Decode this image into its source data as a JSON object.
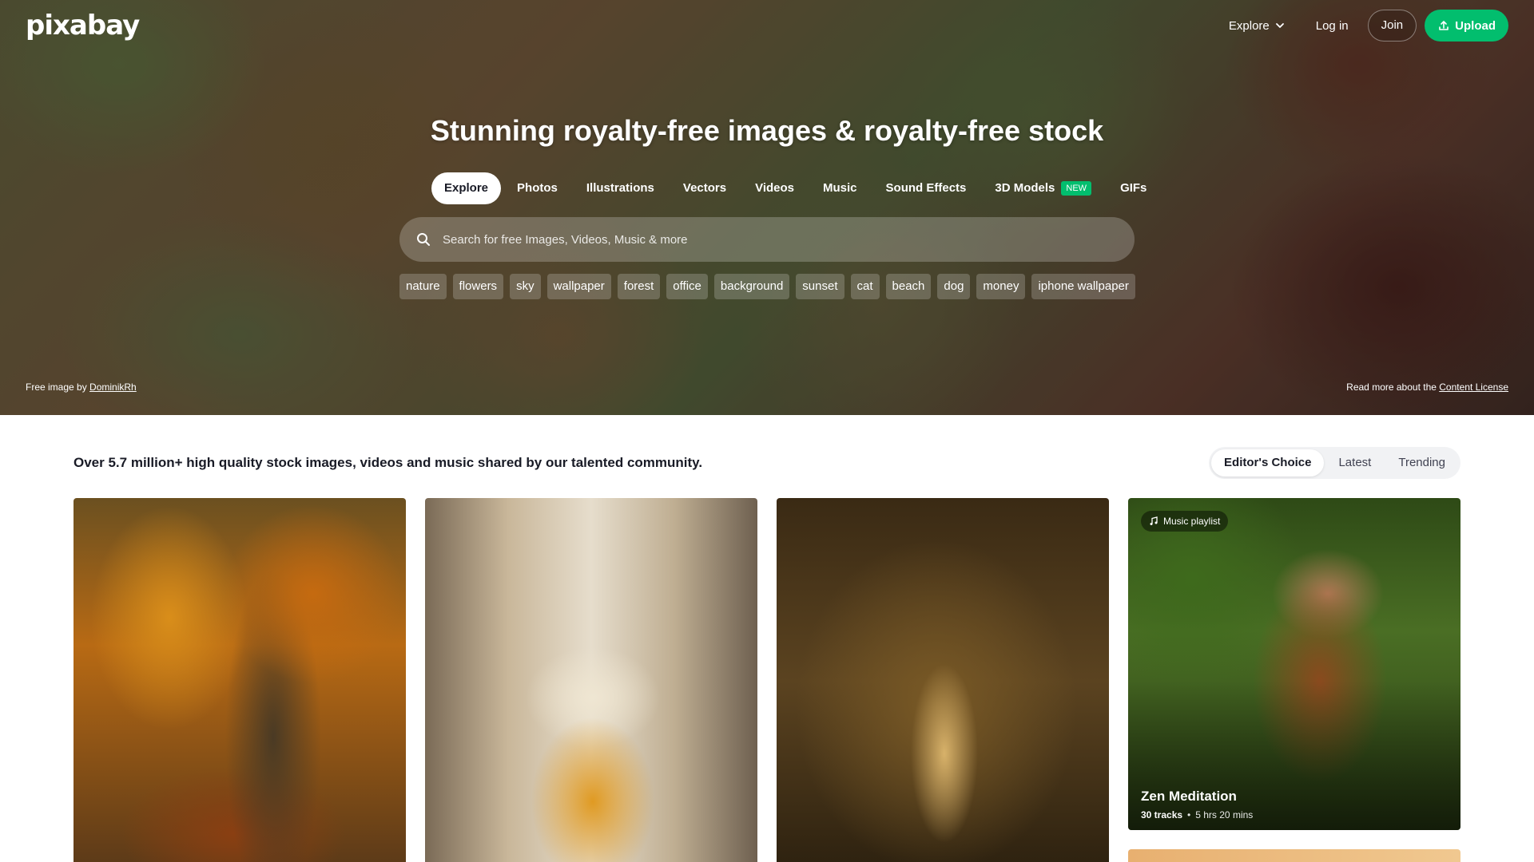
{
  "header": {
    "logo": "pixabay",
    "explore": "Explore",
    "login": "Log in",
    "join": "Join",
    "upload": "Upload"
  },
  "hero": {
    "title": "Stunning royalty-free images & royalty-free stock",
    "tabs": [
      {
        "label": "Explore",
        "active": true
      },
      {
        "label": "Photos"
      },
      {
        "label": "Illustrations"
      },
      {
        "label": "Vectors"
      },
      {
        "label": "Videos"
      },
      {
        "label": "Music"
      },
      {
        "label": "Sound Effects"
      },
      {
        "label": "3D Models",
        "badge": "NEW"
      },
      {
        "label": "GIFs"
      }
    ],
    "search_placeholder": "Search for free Images, Videos, Music & more",
    "chips": [
      "nature",
      "flowers",
      "sky",
      "wallpaper",
      "forest",
      "office",
      "background",
      "sunset",
      "cat",
      "beach",
      "dog",
      "money",
      "iphone wallpaper"
    ],
    "credit_prefix": "Free image by",
    "credit_author": "DominikRh",
    "license_prefix": "Read more about the",
    "license_link": "Content License"
  },
  "section": {
    "tagline": "Over 5.7 million+ high quality stock images, videos and music shared by our talented community.",
    "filters": [
      "Editor's Choice",
      "Latest",
      "Trending"
    ]
  },
  "playlist": {
    "badge": "Music playlist",
    "title": "Zen Meditation",
    "tracks": "30 tracks",
    "separator": "•",
    "duration": "5 hrs 20 mins"
  },
  "colors": {
    "accent": "#02be6e",
    "text": "#191b26"
  }
}
